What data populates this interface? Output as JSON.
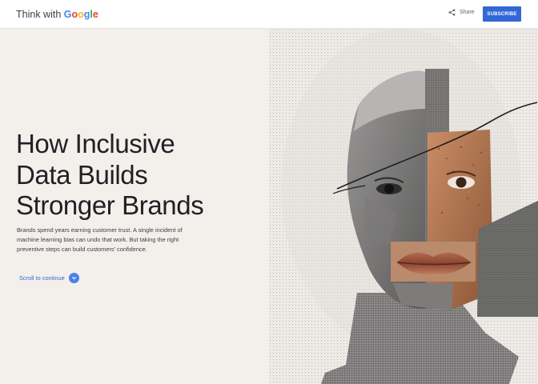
{
  "header": {
    "logo_lead": "Think with ",
    "logo_brand": [
      "G",
      "o",
      "o",
      "g",
      "l",
      "e"
    ],
    "brand_colors": [
      "#4285f4",
      "#ea4335",
      "#fbbc05",
      "#4285f4",
      "#34a853",
      "#ea4335"
    ],
    "share_icon": "share-icon",
    "share_label": "Share",
    "subscribe_label": "SUBSCRIBE"
  },
  "hero": {
    "title_lines": [
      "How Inclusive",
      "Data Builds",
      "Stronger Brands"
    ],
    "description": "Brands spend years earning customer trust. A single incident of machine learning bias can undo that work. But taking the right preventive steps can build customers’ confidence.",
    "scroll_label": "Scroll to continue",
    "scroll_icon": "chevron-down-icon"
  },
  "colors": {
    "accent": "#3367d6",
    "background": "#f3efeb"
  }
}
